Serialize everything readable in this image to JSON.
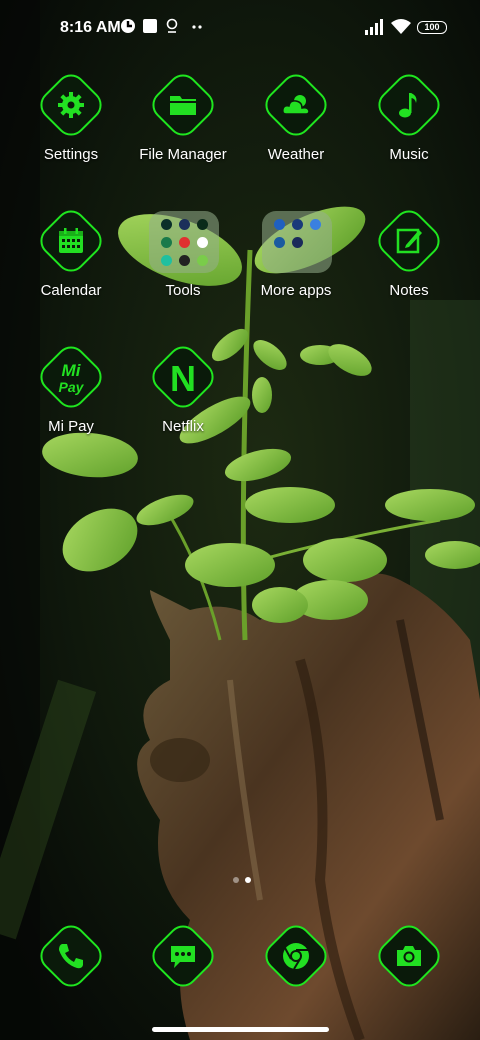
{
  "status_bar": {
    "time": "8:16 AM",
    "battery": "100",
    "left_icons": [
      "app-notification-icon",
      "square-notification-icon",
      "location-icon",
      "more-dots-icon"
    ],
    "right_icons": [
      "signal-icon",
      "wifi-icon",
      "battery-icon"
    ]
  },
  "apps": {
    "settings": "Settings",
    "file_manager": "File Manager",
    "weather": "Weather",
    "music": "Music",
    "calendar": "Calendar",
    "tools": "Tools",
    "more_apps": "More apps",
    "notes": "Notes",
    "mi_pay": "Mi Pay",
    "netflix": "Netflix"
  },
  "glyph_text": {
    "netflix": "N",
    "mi_pay_top": "Mi",
    "mi_pay_bottom": "Pay"
  },
  "dock": [
    "phone-icon",
    "messages-icon",
    "chrome-icon",
    "camera-icon"
  ],
  "pagination": {
    "pages": 2,
    "current": 2
  },
  "theme": {
    "accent": "#1fe61f",
    "tile_bg": "#0a1a0a",
    "glyph": "#22e022"
  }
}
